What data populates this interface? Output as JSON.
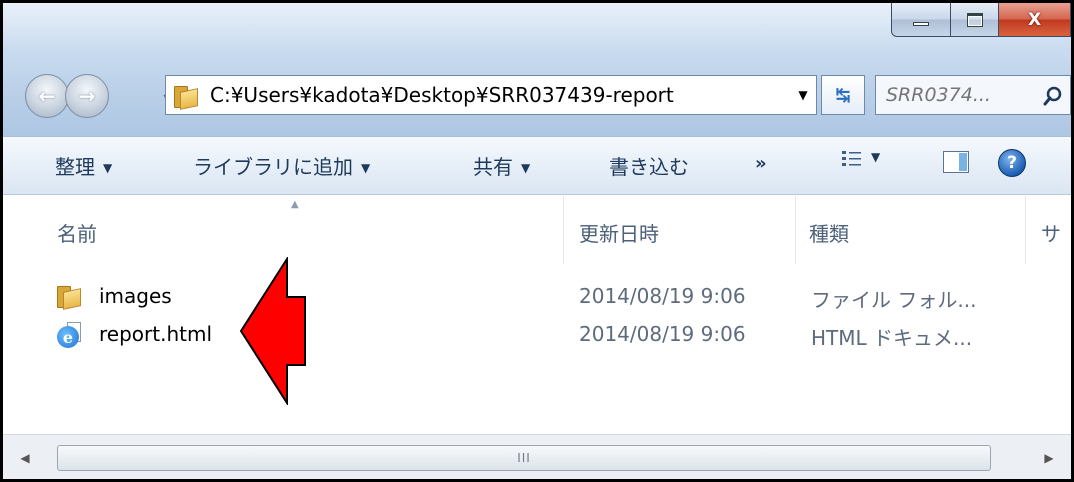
{
  "window": {
    "caption": {
      "close_glyph": "X"
    }
  },
  "navigation": {
    "back_glyph": "←",
    "forward_glyph": "→",
    "history_glyph": "▾"
  },
  "address_bar": {
    "path": "C:¥Users¥kadota¥Desktop¥SRR037439-report",
    "dropdown_glyph": "▼",
    "refresh_glyph": "↹"
  },
  "search": {
    "placeholder": "SRR0374..."
  },
  "toolbar": {
    "organize": "整理",
    "add_to_library": "ライブラリに追加",
    "share": "共有",
    "burn": "書き込む",
    "more": "»",
    "caret": "▼",
    "help_glyph": "?"
  },
  "columns": {
    "name": "名前",
    "date_modified": "更新日時",
    "type": "種類",
    "size": "サ",
    "sort_glyph": "▲"
  },
  "files": [
    {
      "name": "images",
      "date": "2014/08/19 9:06",
      "type": "ファイル フォル...",
      "icon": "folder-icon"
    },
    {
      "name": "report.html",
      "date": "2014/08/19 9:06",
      "type": "HTML ドキュメ...",
      "icon": "ie-html-icon"
    }
  ],
  "scrollbar": {
    "left_glyph": "◀",
    "right_glyph": "▶",
    "grip": "III"
  },
  "colors": {
    "arrow_fill": "#ff0000",
    "arrow_stroke": "#000000",
    "toolbar_text": "#1e395b",
    "secondary_text": "#5d6b7c"
  }
}
